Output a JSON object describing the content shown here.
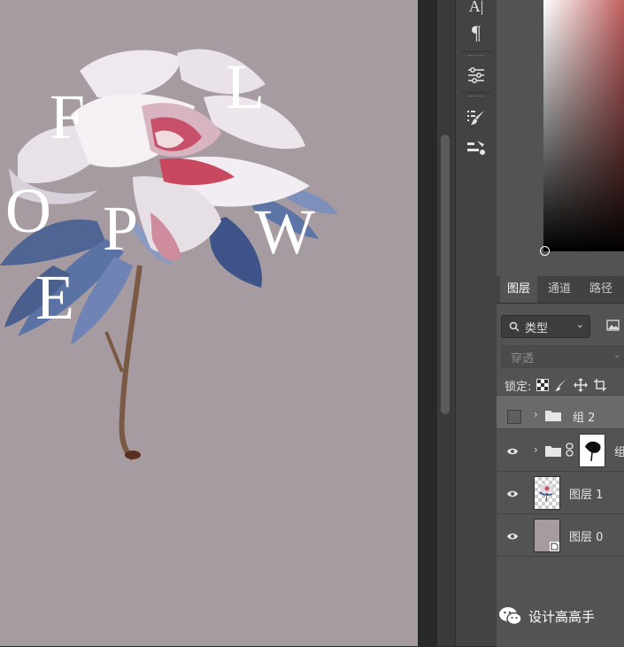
{
  "canvas": {
    "background": "#a69ba1",
    "letters": [
      "F",
      "L",
      "O",
      "P",
      "W",
      "E"
    ]
  },
  "toolstrip": {
    "tools": [
      "character-icon",
      "paragraph-icon",
      "adjustments-icon",
      "brush-settings-icon",
      "tool-presets-icon"
    ],
    "glyph_char": "A|",
    "glyph_para": "¶"
  },
  "layers_panel": {
    "tabs": [
      "图层",
      "通道",
      "路径"
    ],
    "active_tab": "图层",
    "filter_label": "类型",
    "blend_mode": "穿透",
    "lock_label": "锁定:",
    "layers": [
      {
        "name": "组 2",
        "type": "group",
        "visible": false,
        "selected": true
      },
      {
        "name": "组",
        "type": "group-with-mask",
        "visible": true,
        "selected": false
      },
      {
        "name": "图层 1",
        "type": "layer",
        "visible": true,
        "selected": false
      },
      {
        "name": "图层 0",
        "type": "smart-object",
        "visible": true,
        "selected": false
      }
    ]
  },
  "watermark": {
    "text": "设计高高手"
  }
}
